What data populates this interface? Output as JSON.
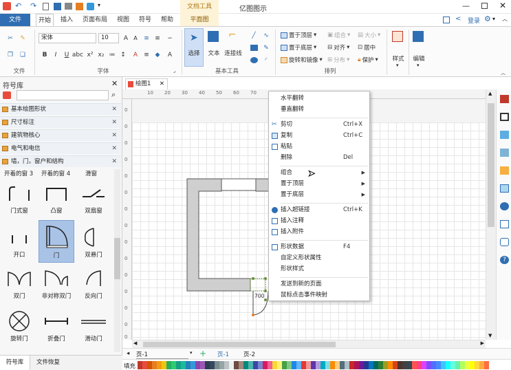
{
  "title_bar": {
    "app_title": "亿图图示",
    "login_label": "登录"
  },
  "ribbon_tabs": {
    "file": "文件",
    "home": "开始",
    "insert": "插入",
    "page_layout": "页面布局",
    "view": "视图",
    "symbol": "符号",
    "help": "帮助",
    "doc_tool": "文档工具",
    "flat_view": "平面图"
  },
  "ribbon": {
    "groups": {
      "file": "文件",
      "font": "字体",
      "basic_tools": "基本工具",
      "arrange": "排列"
    },
    "font_name": "宋体",
    "font_size": "10",
    "select_label": "选择",
    "text_label": "文本",
    "connector_label": "连接线",
    "bring_front": "置于顶层",
    "send_back": "置于底层",
    "rotate_mirror": "旋转和镜像",
    "group": "组合",
    "size": "大小",
    "align": "对齐",
    "center": "居中",
    "distribute": "分布",
    "protect": "保护",
    "style_label": "样式",
    "edit_label": "编辑"
  },
  "left_panel": {
    "title": "符号库",
    "libraries": [
      "基本绘图形状",
      "尺寸标注",
      "建筑物核心",
      "电气和电信",
      "墙，门，窗户和结构"
    ],
    "top_labels": [
      "开着的窗 3",
      "开着的窗 4",
      "滑窗"
    ],
    "shapes": [
      {
        "label": "门式窗"
      },
      {
        "label": "凸窗"
      },
      {
        "label": "双扇窗"
      },
      {
        "label": "开口"
      },
      {
        "label": "门"
      },
      {
        "label": "双悬门"
      },
      {
        "label": "双门"
      },
      {
        "label": "非对称双门"
      },
      {
        "label": "反向门"
      },
      {
        "label": "旋转门"
      },
      {
        "label": "折叠门"
      },
      {
        "label": "滑动门"
      }
    ],
    "bottom_tabs": [
      "符号库",
      "文件恢复"
    ]
  },
  "document": {
    "tab_label": "绘图1",
    "page_tabs": {
      "current": "页-1",
      "first": "页-1",
      "second": "页-2"
    },
    "fill_label": "填充",
    "ruler_h": [
      "10",
      "20",
      "30",
      "40",
      "50",
      "60",
      "70"
    ],
    "ruler_v": [
      "0",
      "0",
      "0",
      "0",
      "0",
      "0",
      "0",
      "0",
      "0",
      "0",
      "0",
      "0",
      "0",
      "0",
      "0"
    ],
    "dimension_text": "700"
  },
  "context_menu": {
    "items": [
      {
        "label": "水平翻转",
        "shortcut": "",
        "submenu": false
      },
      {
        "label": "垂直翻转",
        "shortcut": "",
        "submenu": false
      },
      {
        "label": "剪切",
        "shortcut": "Ctrl+X",
        "submenu": false
      },
      {
        "label": "复制",
        "shortcut": "Ctrl+C",
        "submenu": false
      },
      {
        "label": "粘贴",
        "shortcut": "",
        "submenu": false
      },
      {
        "label": "删除",
        "shortcut": "Del",
        "submenu": false
      },
      {
        "label": "组合",
        "shortcut": "",
        "submenu": true
      },
      {
        "label": "置于顶层",
        "shortcut": "",
        "submenu": true
      },
      {
        "label": "置于底层",
        "shortcut": "",
        "submenu": true
      },
      {
        "label": "插入超链接",
        "shortcut": "Ctrl+K",
        "submenu": false
      },
      {
        "label": "插入注释",
        "shortcut": "",
        "submenu": false
      },
      {
        "label": "插入附件",
        "shortcut": "",
        "submenu": false
      },
      {
        "label": "形状数据",
        "shortcut": "F4",
        "submenu": false
      },
      {
        "label": "自定义形状属性",
        "shortcut": "",
        "submenu": false
      },
      {
        "label": "形状样式",
        "shortcut": "",
        "submenu": false
      },
      {
        "label": "发送到新的页面",
        "shortcut": "",
        "submenu": false
      },
      {
        "label": "鼠标点击事件映射",
        "shortcut": "",
        "submenu": false
      }
    ]
  },
  "colors": {
    "accent": "#2f6eb2",
    "wall_fill": "#cfcfcf",
    "selection": "#a9c3e6",
    "palette": [
      "#c0392b",
      "#e74c3c",
      "#d35400",
      "#e67e22",
      "#f39c12",
      "#f1c40f",
      "#27ae60",
      "#2ecc71",
      "#16a085",
      "#1abc9c",
      "#2980b9",
      "#3498db",
      "#8e44ad",
      "#9b59b6",
      "#2c3e50",
      "#34495e",
      "#7f8c8d",
      "#95a5a6",
      "#bdc3c7",
      "#ecf0f1",
      "#6d4c41",
      "#a1887f",
      "#00897b",
      "#4db6ac",
      "#3949ab",
      "#7986cb",
      "#d81b60",
      "#f06292",
      "#fdd835",
      "#fff176",
      "#43a047",
      "#81c784",
      "#1e88e5",
      "#64b5f6",
      "#e53935",
      "#ef9a9a",
      "#5e35b1",
      "#b39ddb",
      "#00acc1",
      "#80deea",
      "#fb8c00",
      "#ffcc80",
      "#546e7a",
      "#b0bec5",
      "#c62828",
      "#ad1457",
      "#6a1b9a",
      "#283593",
      "#0277bd",
      "#00695c",
      "#2e7d32",
      "#9e9d24",
      "#ff8f00",
      "#d84315",
      "#4e342e",
      "#424242",
      "#37474f",
      "#ff5252",
      "#ff4081",
      "#e040fb",
      "#7c4dff",
      "#536dfe",
      "#448aff",
      "#40c4ff",
      "#18ffff",
      "#64ffda",
      "#69f0ae",
      "#b2ff59",
      "#eeff41",
      "#ffff00",
      "#ffd740",
      "#ffab40",
      "#ff6e40"
    ]
  }
}
